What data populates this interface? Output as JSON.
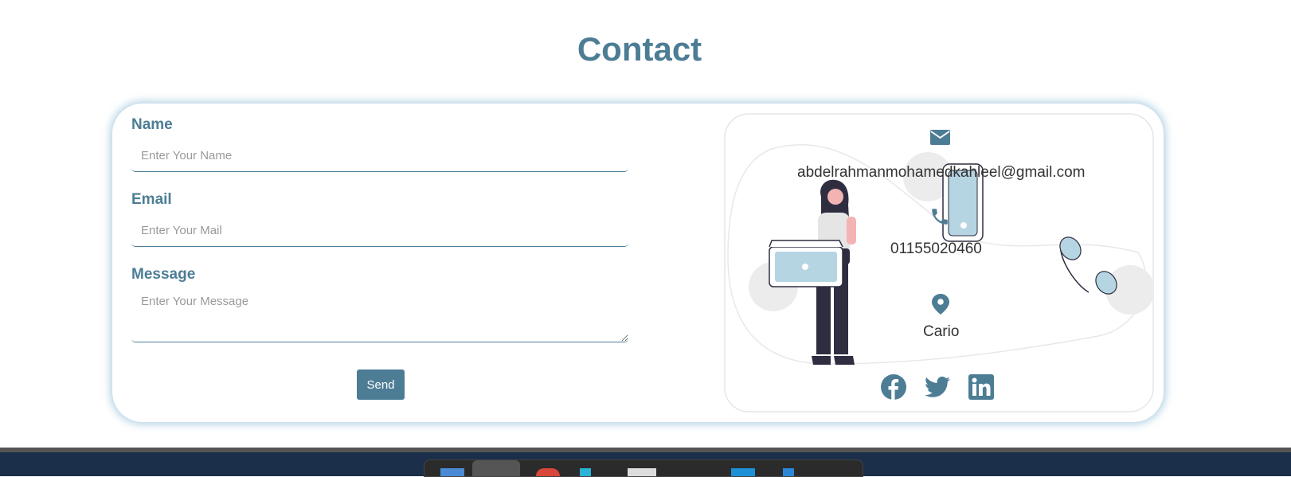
{
  "section": {
    "title": "Contact"
  },
  "form": {
    "name_label": "Name",
    "name_placeholder": "Enter Your Name",
    "email_label": "Email",
    "email_placeholder": "Enter Your Mail",
    "message_label": "Message",
    "message_placeholder": "Enter Your Message",
    "send_label": "Send"
  },
  "contact": {
    "email": "abdelrahmanmohamedkahleel@gmail.com",
    "phone": "01155020460",
    "location": "Cario"
  },
  "icons": {
    "email": "envelope-icon",
    "phone": "phone-icon",
    "location": "map-pin-icon",
    "social": [
      "facebook-icon",
      "twitter-icon",
      "linkedin-icon"
    ]
  },
  "colors": {
    "accent": "#4d7d95",
    "card_glow": "#78afcd",
    "illustration_blue": "#b6d5e3"
  }
}
